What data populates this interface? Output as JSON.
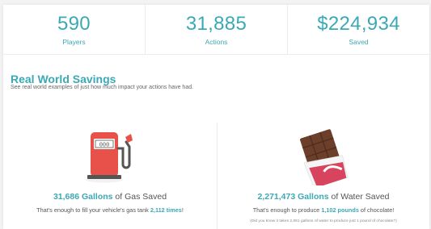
{
  "stats": [
    {
      "value": "590",
      "label": "Players"
    },
    {
      "value": "31,885",
      "label": "Actions"
    },
    {
      "value": "$224,934",
      "label": "Saved"
    }
  ],
  "section": {
    "title": "Real World Savings",
    "subtitle": "See real world examples of just how much impact your actions have had."
  },
  "gas": {
    "icon": "gas-pump-icon",
    "amount": "31,686 Gallons",
    "headline_suffix": " of Gas Saved",
    "desc_prefix": "That's enough to fill your vehicle's gas tank ",
    "desc_highlight": "2,112 times",
    "desc_suffix": "!"
  },
  "water": {
    "icon": "chocolate-bar-icon",
    "amount": "2,271,473 Gallons",
    "headline_suffix": " of Water Saved",
    "desc_prefix": "That's enough to produce ",
    "desc_highlight": "1,102 pounds",
    "desc_suffix": " of chocolate!",
    "footnote": "(Did you know it takes 2,061 gallons of water to produce just 1 pound of chocolate?)"
  },
  "colors": {
    "accent": "#3ba9b5",
    "pump": "#e8514a",
    "chocolate": "#6b3f2a"
  }
}
